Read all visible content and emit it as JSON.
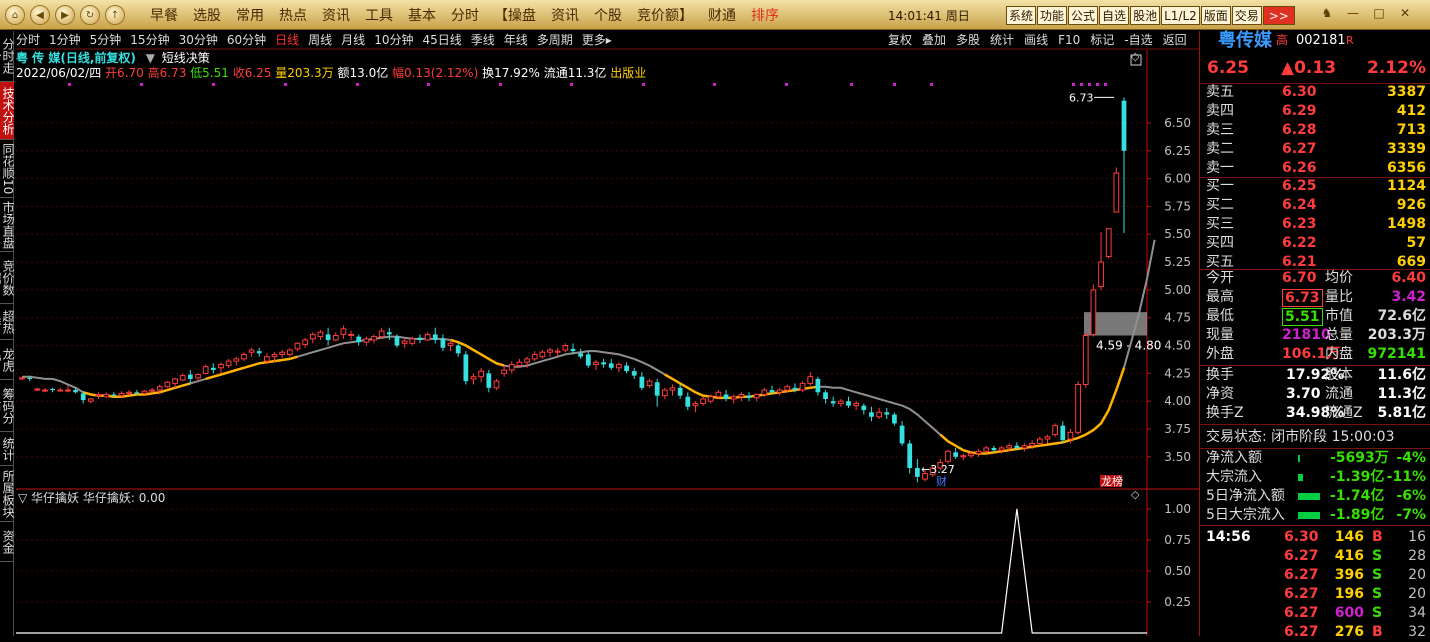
{
  "app_buttons": [
    "⌂",
    "◀",
    "▶",
    "↻",
    "↑"
  ],
  "menu": [
    "早餐",
    "选股",
    "常用",
    "热点",
    "资讯",
    "工具",
    "基本",
    "分时",
    "【操盘",
    "资讯",
    "个股",
    "竞价额】",
    "财通",
    "排序"
  ],
  "clock": "14:01:41 周日",
  "top_right": [
    "系统",
    "功能",
    "公式",
    "自选",
    "股池",
    "L1/L2",
    "版面",
    "交易",
    ">>"
  ],
  "top_icons": [
    "♞",
    "—",
    "□",
    "✕"
  ],
  "sidebar": [
    "分时走势",
    "技术分析",
    "同花顺10",
    "市场直盘",
    "竞价数据",
    "超热排",
    "龙虎榜",
    "筹码分布",
    "统计",
    "所属板块",
    "资金"
  ],
  "periods": [
    "分时",
    "1分钟",
    "5分钟",
    "15分钟",
    "30分钟",
    "60分钟",
    "日线",
    "周线",
    "月线",
    "10分钟",
    "45日线",
    "季线",
    "年线",
    "多周期",
    "更多▸"
  ],
  "selected_period": "日线",
  "tools": [
    "复权",
    "叠加",
    "多股",
    "统计",
    "画线",
    "F10",
    "标记",
    "-自选",
    "返回"
  ],
  "chart_title": "粤 传 媒(日线,前复权)",
  "indicator_name": "短线决策",
  "info": {
    "date": "2022/06/02/四",
    "open": "开6.70",
    "high": "高6.73",
    "low": "低5.51",
    "close": "收6.25",
    "vol": "量203.3万",
    "amt": "额13.0亿",
    "chg": "幅0.13(2.12%)",
    "turnover": "换17.92%",
    "float": "流通11.3亿",
    "status": "出版业"
  },
  "sub_indicator": "华仔擒妖 华仔擒妖: 0.00",
  "chart_data": {
    "type": "candlestick",
    "y_ticks": [
      3.5,
      3.75,
      4.0,
      4.25,
      4.5,
      4.75,
      5.0,
      5.25,
      5.5,
      5.75,
      6.0,
      6.25,
      6.5
    ],
    "sub_ticks": [
      0.25,
      0.5,
      0.75,
      1.0
    ],
    "high_label": "6.73",
    "low_label": "3.27",
    "zone_label": "4.59 - 4.80",
    "markers": {
      "cai": "财",
      "longhu": "龙榜"
    },
    "candles": [
      [
        4.2,
        4.22,
        4.19,
        4.21
      ],
      [
        4.21,
        4.23,
        4.18,
        4.2
      ],
      [
        4.1,
        4.12,
        4.09,
        4.11
      ],
      [
        4.1,
        4.12,
        4.08,
        4.1
      ],
      [
        4.11,
        4.12,
        4.08,
        4.1
      ],
      [
        4.1,
        4.12,
        4.09,
        4.1
      ],
      [
        4.1,
        4.14,
        4.08,
        4.1
      ],
      [
        4.1,
        4.12,
        4.07,
        4.08
      ],
      [
        4.07,
        4.09,
        3.98,
        4.01
      ],
      [
        4.0,
        4.03,
        3.98,
        4.02
      ],
      [
        4.05,
        4.08,
        4.02,
        4.06
      ],
      [
        4.04,
        4.08,
        4.03,
        4.06
      ],
      [
        4.06,
        4.08,
        4.04,
        4.05
      ],
      [
        4.05,
        4.09,
        4.03,
        4.07
      ],
      [
        4.07,
        4.1,
        4.05,
        4.08
      ],
      [
        4.08,
        4.1,
        4.05,
        4.07
      ],
      [
        4.07,
        4.1,
        4.06,
        4.09
      ],
      [
        4.09,
        4.12,
        4.07,
        4.1
      ],
      [
        4.1,
        4.15,
        4.06,
        4.13
      ],
      [
        4.13,
        4.18,
        4.12,
        4.17
      ],
      [
        4.16,
        4.21,
        4.12,
        4.2
      ],
      [
        4.19,
        4.25,
        4.18,
        4.23
      ],
      [
        4.24,
        4.28,
        4.15,
        4.2
      ],
      [
        4.21,
        4.25,
        4.17,
        4.24
      ],
      [
        4.25,
        4.33,
        4.24,
        4.31
      ],
      [
        4.3,
        4.34,
        4.25,
        4.28
      ],
      [
        4.3,
        4.35,
        4.25,
        4.33
      ],
      [
        4.32,
        4.38,
        4.3,
        4.36
      ],
      [
        4.36,
        4.4,
        4.32,
        4.38
      ],
      [
        4.38,
        4.44,
        4.36,
        4.42
      ],
      [
        4.44,
        4.48,
        4.4,
        4.46
      ],
      [
        4.45,
        4.48,
        4.4,
        4.43
      ],
      [
        4.36,
        4.43,
        4.33,
        4.4
      ],
      [
        4.4,
        4.44,
        4.35,
        4.42
      ],
      [
        4.42,
        4.46,
        4.39,
        4.44
      ],
      [
        4.42,
        4.48,
        4.4,
        4.46
      ],
      [
        4.47,
        4.53,
        4.45,
        4.52
      ],
      [
        4.51,
        4.57,
        4.48,
        4.55
      ],
      [
        4.56,
        4.62,
        4.52,
        4.6
      ],
      [
        4.58,
        4.64,
        4.55,
        4.62
      ],
      [
        4.6,
        4.66,
        4.5,
        4.55
      ],
      [
        4.55,
        4.62,
        4.54,
        4.59
      ],
      [
        4.6,
        4.68,
        4.56,
        4.65
      ],
      [
        4.6,
        4.63,
        4.55,
        4.6
      ],
      [
        4.58,
        4.6,
        4.5,
        4.53
      ],
      [
        4.53,
        4.58,
        4.5,
        4.56
      ],
      [
        4.55,
        4.6,
        4.52,
        4.58
      ],
      [
        4.58,
        4.66,
        4.56,
        4.63
      ],
      [
        4.62,
        4.66,
        4.55,
        4.6
      ],
      [
        4.58,
        4.6,
        4.48,
        4.5
      ],
      [
        4.52,
        4.56,
        4.48,
        4.54
      ],
      [
        4.52,
        4.58,
        4.5,
        4.56
      ],
      [
        4.57,
        4.6,
        4.52,
        4.55
      ],
      [
        4.55,
        4.62,
        4.54,
        4.6
      ],
      [
        4.6,
        4.66,
        4.52,
        4.55
      ],
      [
        4.56,
        4.6,
        4.45,
        4.48
      ],
      [
        4.5,
        4.55,
        4.45,
        4.52
      ],
      [
        4.5,
        4.52,
        4.4,
        4.43
      ],
      [
        4.42,
        4.45,
        4.15,
        4.18
      ],
      [
        4.2,
        4.25,
        4.15,
        4.22
      ],
      [
        4.22,
        4.3,
        4.17,
        4.27
      ],
      [
        4.25,
        4.28,
        4.08,
        4.12
      ],
      [
        4.12,
        4.2,
        4.1,
        4.18
      ],
      [
        4.25,
        4.32,
        4.22,
        4.28
      ],
      [
        4.28,
        4.36,
        4.25,
        4.33
      ],
      [
        4.32,
        4.38,
        4.3,
        4.35
      ],
      [
        4.35,
        4.4,
        4.3,
        4.38
      ],
      [
        4.38,
        4.45,
        4.36,
        4.42
      ],
      [
        4.4,
        4.46,
        4.38,
        4.44
      ],
      [
        4.44,
        4.48,
        4.4,
        4.46
      ],
      [
        4.44,
        4.48,
        4.4,
        4.45
      ],
      [
        4.46,
        4.52,
        4.44,
        4.5
      ],
      [
        4.47,
        4.52,
        4.42,
        4.45
      ],
      [
        4.43,
        4.47,
        4.38,
        4.4
      ],
      [
        4.42,
        4.45,
        4.3,
        4.32
      ],
      [
        4.33,
        4.37,
        4.28,
        4.35
      ],
      [
        4.35,
        4.38,
        4.3,
        4.33
      ],
      [
        4.34,
        4.38,
        4.28,
        4.3
      ],
      [
        4.3,
        4.35,
        4.26,
        4.33
      ],
      [
        4.32,
        4.35,
        4.25,
        4.27
      ],
      [
        4.27,
        4.3,
        4.2,
        4.23
      ],
      [
        4.22,
        4.26,
        4.1,
        4.12
      ],
      [
        4.14,
        4.2,
        4.12,
        4.18
      ],
      [
        4.17,
        4.2,
        3.95,
        4.05
      ],
      [
        4.05,
        4.12,
        4.02,
        4.1
      ],
      [
        4.1,
        4.15,
        4.05,
        4.12
      ],
      [
        4.12,
        4.16,
        4.02,
        4.05
      ],
      [
        4.04,
        4.08,
        3.92,
        3.95
      ],
      [
        3.96,
        4.0,
        3.9,
        3.98
      ],
      [
        3.98,
        4.04,
        3.96,
        4.02
      ],
      [
        4.0,
        4.06,
        3.98,
        4.04
      ],
      [
        4.04,
        4.1,
        4.02,
        4.08
      ],
      [
        4.06,
        4.1,
        4.0,
        4.02
      ],
      [
        4.02,
        4.06,
        3.98,
        4.04
      ],
      [
        4.04,
        4.08,
        4.0,
        4.06
      ],
      [
        4.05,
        4.08,
        4.0,
        4.03
      ],
      [
        4.03,
        4.07,
        4.0,
        4.06
      ],
      [
        4.06,
        4.12,
        4.04,
        4.1
      ],
      [
        4.1,
        4.14,
        4.06,
        4.08
      ],
      [
        4.08,
        4.12,
        4.05,
        4.1
      ],
      [
        4.1,
        4.15,
        4.08,
        4.13
      ],
      [
        4.12,
        4.16,
        4.08,
        4.1
      ],
      [
        4.1,
        4.18,
        4.08,
        4.16
      ],
      [
        4.16,
        4.26,
        4.14,
        4.22
      ],
      [
        4.2,
        4.22,
        4.05,
        4.08
      ],
      [
        4.08,
        4.1,
        3.98,
        4.02
      ],
      [
        4.0,
        4.04,
        3.95,
        3.98
      ],
      [
        3.98,
        4.02,
        3.95,
        4.0
      ],
      [
        4.0,
        4.04,
        3.94,
        3.96
      ],
      [
        3.96,
        4.0,
        3.92,
        3.98
      ],
      [
        3.96,
        3.98,
        3.88,
        3.92
      ],
      [
        3.9,
        3.95,
        3.82,
        3.86
      ],
      [
        3.86,
        3.94,
        3.84,
        3.9
      ],
      [
        3.9,
        3.94,
        3.84,
        3.88
      ],
      [
        3.88,
        3.9,
        3.78,
        3.8
      ],
      [
        3.78,
        3.82,
        3.6,
        3.62
      ],
      [
        3.62,
        3.65,
        3.35,
        3.4
      ],
      [
        3.4,
        3.48,
        3.27,
        3.32
      ],
      [
        3.3,
        3.38,
        3.28,
        3.35
      ],
      [
        3.34,
        3.42,
        3.32,
        3.4
      ],
      [
        3.4,
        3.48,
        3.38,
        3.45
      ],
      [
        3.46,
        3.56,
        3.44,
        3.55
      ],
      [
        3.54,
        3.58,
        3.48,
        3.5
      ],
      [
        3.5,
        3.53,
        3.47,
        3.51
      ],
      [
        3.51,
        3.55,
        3.49,
        3.53
      ],
      [
        3.53,
        3.57,
        3.5,
        3.55
      ],
      [
        3.55,
        3.6,
        3.53,
        3.58
      ],
      [
        3.58,
        3.6,
        3.54,
        3.56
      ],
      [
        3.56,
        3.6,
        3.53,
        3.58
      ],
      [
        3.58,
        3.62,
        3.55,
        3.6
      ],
      [
        3.6,
        3.63,
        3.56,
        3.58
      ],
      [
        3.58,
        3.62,
        3.55,
        3.6
      ],
      [
        3.6,
        3.65,
        3.57,
        3.62
      ],
      [
        3.62,
        3.68,
        3.6,
        3.66
      ],
      [
        3.66,
        3.7,
        3.62,
        3.68
      ],
      [
        3.7,
        3.8,
        3.68,
        3.78
      ],
      [
        3.78,
        3.82,
        3.62,
        3.65
      ],
      [
        3.66,
        3.75,
        3.62,
        3.72
      ],
      [
        3.72,
        4.18,
        3.7,
        4.15
      ],
      [
        4.15,
        4.62,
        4.12,
        4.59
      ],
      [
        4.6,
        5.05,
        4.58,
        5.0
      ],
      [
        5.03,
        5.52,
        5.0,
        5.25
      ],
      [
        5.3,
        5.55,
        5.28,
        5.55
      ],
      [
        5.7,
        6.1,
        5.7,
        6.05
      ],
      [
        6.7,
        6.73,
        5.51,
        6.25
      ]
    ],
    "ma_grey": [
      4.22,
      4.22,
      4.21,
      4.2,
      4.2,
      4.18,
      4.15,
      4.12,
      4.08,
      4.06,
      4.05,
      4.05,
      4.04,
      4.04,
      4.05,
      4.06,
      4.06,
      4.07,
      4.08,
      4.1,
      4.12,
      4.14,
      4.16,
      4.18,
      4.2,
      4.22,
      4.24,
      4.26,
      4.28,
      4.3,
      4.32,
      4.34,
      4.35,
      4.36,
      4.37,
      4.38,
      4.4,
      4.42,
      4.44,
      4.46,
      4.48,
      4.5,
      4.52,
      4.53,
      4.54,
      4.55,
      4.56,
      4.57,
      4.58,
      4.58,
      4.57,
      4.56,
      4.56,
      4.56,
      4.56,
      4.56,
      4.55,
      4.53,
      4.5,
      4.46,
      4.42,
      4.38,
      4.34,
      4.32,
      4.31,
      4.31,
      4.32,
      4.34,
      4.36,
      4.38,
      4.4,
      4.42,
      4.43,
      4.44,
      4.45,
      4.45,
      4.44,
      4.43,
      4.42,
      4.4,
      4.38,
      4.35,
      4.32,
      4.28,
      4.24,
      4.2,
      4.16,
      4.12,
      4.08,
      4.05,
      4.04,
      4.03,
      4.03,
      4.03,
      4.04,
      4.04,
      4.05,
      4.06,
      4.07,
      4.08,
      4.09,
      4.1,
      4.11,
      4.12,
      4.13,
      4.13,
      4.12,
      4.12,
      4.1,
      4.08,
      4.06,
      4.04,
      4.02,
      4.0,
      3.98,
      3.96,
      3.93,
      3.88,
      3.82,
      3.76,
      3.7,
      3.64,
      3.6,
      3.56,
      3.54,
      3.53,
      3.53,
      3.54,
      3.55,
      3.56,
      3.57,
      3.58,
      3.59,
      3.6,
      3.61,
      3.62,
      3.63,
      3.65,
      3.67,
      3.7,
      3.74,
      3.8,
      3.92,
      4.1,
      4.3,
      4.55,
      4.8,
      5.1,
      5.45
    ],
    "ma_gold_ranges": [
      [
        8,
        22
      ],
      [
        24,
        36
      ],
      [
        56,
        63
      ],
      [
        84,
        104
      ],
      [
        120,
        148
      ]
    ],
    "sub_spike": [
      [
        128,
        0
      ],
      [
        130,
        1
      ],
      [
        132,
        0
      ]
    ]
  },
  "quote": {
    "name": "粤传媒",
    "tag": "高",
    "code": "002181",
    "r": "R",
    "price": "6.25",
    "chg": "▲0.13",
    "pct": "2.12%"
  },
  "asks": [
    [
      "卖五",
      "6.30",
      "3387"
    ],
    [
      "卖四",
      "6.29",
      "412"
    ],
    [
      "卖三",
      "6.28",
      "713"
    ],
    [
      "卖二",
      "6.27",
      "3339"
    ],
    [
      "卖一",
      "6.26",
      "6356"
    ]
  ],
  "bids": [
    [
      "买一",
      "6.25",
      "1124"
    ],
    [
      "买二",
      "6.24",
      "926"
    ],
    [
      "买三",
      "6.23",
      "1498"
    ],
    [
      "买四",
      "6.22",
      "57"
    ],
    [
      "买五",
      "6.21",
      "669"
    ]
  ],
  "stats": [
    [
      "今开",
      "6.70",
      "均价",
      "6.40"
    ],
    [
      "最高",
      "6.73",
      "量比",
      "3.42"
    ],
    [
      "最低",
      "5.51",
      "市值",
      "72.6亿"
    ],
    [
      "现量",
      "21810",
      "总量",
      "203.3万"
    ],
    [
      "外盘",
      "106.1万",
      "内盘",
      "972141"
    ]
  ],
  "stats2": [
    [
      "换手",
      "17.92%",
      "股本",
      "11.6亿"
    ],
    [
      "净资",
      "3.70",
      "流通",
      "11.3亿"
    ],
    [
      "换手Z",
      "34.98%",
      "流通Z",
      "5.81亿"
    ]
  ],
  "trade_status": "交易状态: 闭市阶段 15:00:03",
  "flows": [
    [
      "净流入额",
      "-5693万",
      "-4%",
      0.08
    ],
    [
      "大宗流入",
      "-1.39亿",
      "-11%",
      0.22
    ],
    [
      "5日净流入额",
      "-1.74亿",
      "-6%",
      0.9
    ],
    [
      "5日大宗流入",
      "-1.89亿",
      "-7%",
      0.9
    ]
  ],
  "ticks": [
    [
      "14:56",
      "6.30",
      "146",
      "B",
      "16"
    ],
    [
      "",
      "6.27",
      "416",
      "S",
      "28"
    ],
    [
      "",
      "6.27",
      "396",
      "S",
      "20"
    ],
    [
      "",
      "6.27",
      "196",
      "S",
      "20"
    ],
    [
      "",
      "6.27",
      "600",
      "S",
      "34"
    ],
    [
      "",
      "6.27",
      "276",
      "B",
      "32"
    ]
  ],
  "colors": {
    "up": "#ff3c3c",
    "down": "#36e0e0",
    "gold": "#ffb000",
    "grey": "#909090"
  }
}
